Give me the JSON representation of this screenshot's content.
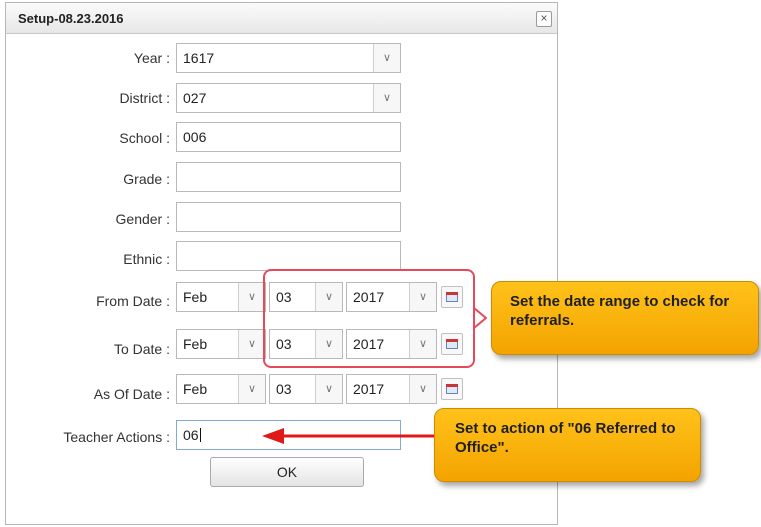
{
  "dialog": {
    "title": "Setup-08.23.2016",
    "close_glyph": "×"
  },
  "fields": {
    "year": {
      "label": "Year :",
      "value": "1617"
    },
    "district": {
      "label": "District :",
      "value": "027"
    },
    "school": {
      "label": "School :",
      "value": "006"
    },
    "grade": {
      "label": "Grade :",
      "value": ""
    },
    "gender": {
      "label": "Gender :",
      "value": ""
    },
    "ethnic": {
      "label": "Ethnic :",
      "value": ""
    },
    "from_date": {
      "label": "From Date :",
      "month": "Feb",
      "day": "03",
      "year": "2017"
    },
    "to_date": {
      "label": "To Date :",
      "month": "Feb",
      "day": "03",
      "year": "2017"
    },
    "as_of_date": {
      "label": "As Of Date :",
      "month": "Feb",
      "day": "03",
      "year": "2017"
    },
    "teacher_actions": {
      "label": "Teacher Actions :",
      "value": "06"
    }
  },
  "ok_label": "OK",
  "callouts": {
    "date_range": "Set the date range to check for referrals.",
    "action": "Set to action of \"06 Referred to Office\"."
  },
  "colors": {
    "callout": "#f8b30a",
    "highlight": "#e64a5a",
    "arrow": "#e01818"
  },
  "icons": {
    "dropdown": "chevron-down-icon",
    "calendar": "calendar-icon",
    "close": "close-icon"
  }
}
